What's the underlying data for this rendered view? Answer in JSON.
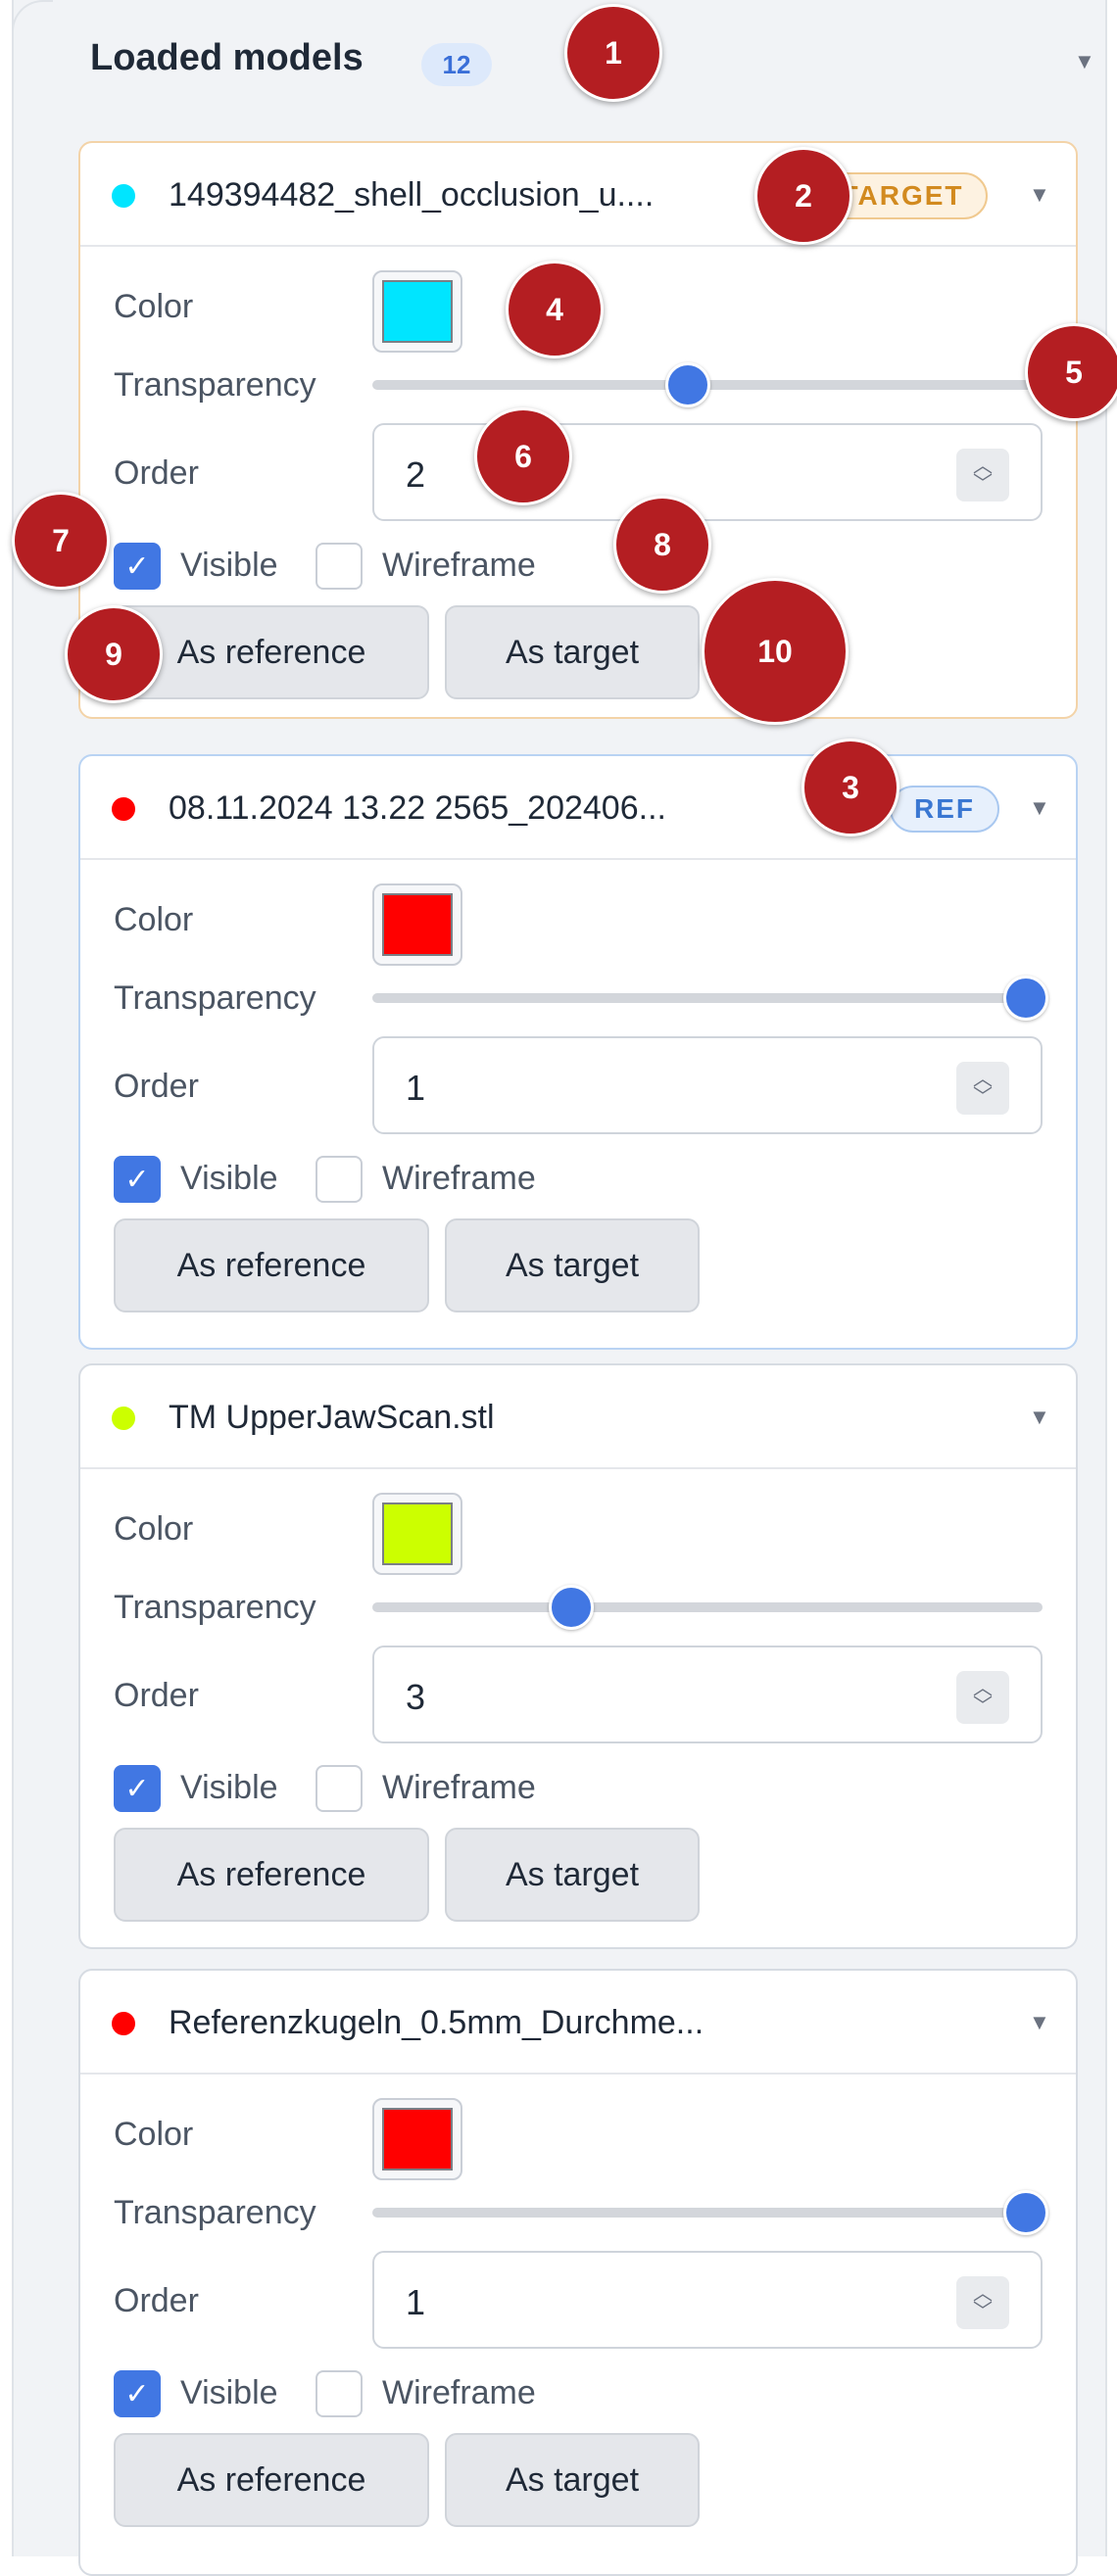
{
  "panel": {
    "title": "Loaded models",
    "count": "12"
  },
  "labels": {
    "color": "Color",
    "transparency": "Transparency",
    "order": "Order",
    "visible": "Visible",
    "wireframe": "Wireframe",
    "as_reference": "As reference",
    "as_target": "As target"
  },
  "models": [
    {
      "name": "149394482_shell_occlusion_u....",
      "badge": "TARGET",
      "color": "#00e5ff",
      "transparency": 0.5,
      "order": "2",
      "visible": true,
      "wireframe": false
    },
    {
      "name": "08.11.2024 13.22 2565_202406...",
      "badge": "REF",
      "color": "#ff0000",
      "transparency": 1.0,
      "order": "1",
      "visible": true,
      "wireframe": false
    },
    {
      "name": "TM UpperJawScan.stl",
      "badge": "",
      "color": "#ccff00",
      "transparency": 0.3,
      "order": "3",
      "visible": true,
      "wireframe": false
    },
    {
      "name": "Referenzkugeln_0.5mm_Durchme...",
      "badge": "",
      "color": "#ff0000",
      "transparency": 1.0,
      "order": "1",
      "visible": true,
      "wireframe": false
    }
  ],
  "markers": [
    "1",
    "2",
    "3",
    "4",
    "5",
    "6",
    "7",
    "8",
    "9",
    "10"
  ],
  "icons": {
    "collapse": "chevron-down-icon",
    "check": "check-icon",
    "stepper": "stepper-icon"
  }
}
